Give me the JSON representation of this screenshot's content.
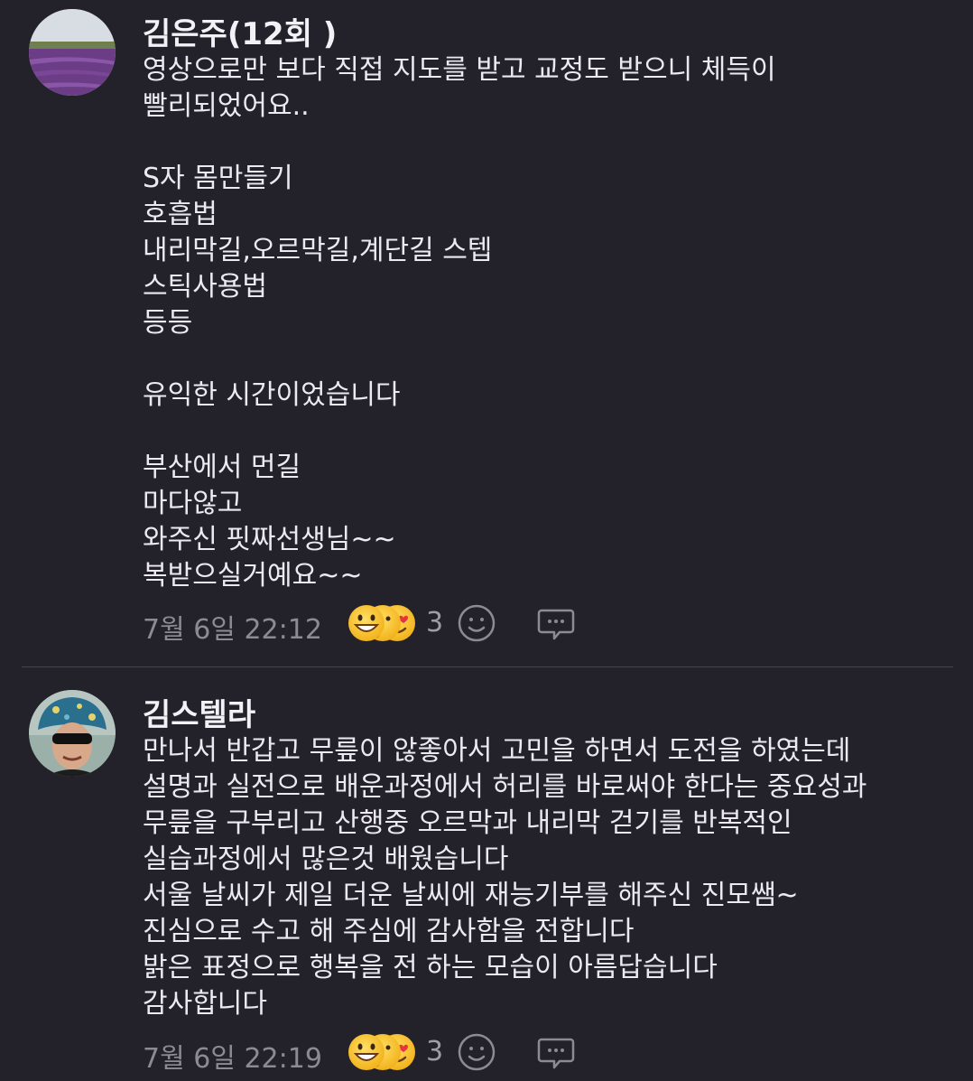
{
  "comments": [
    {
      "author": "김은주(12회 )",
      "text": "영상으로만 보다 직접 지도를 받고 교정도 받으니 체득이\n빨리되었어요..\n\nS자 몸만들기\n호흡법\n내리막길,오르막길,계단길 스텝\n스틱사용법\n등등\n\n유익한 시간이었습니다\n\n부산에서 먼길\n마다않고\n와주신 핏짜선생님~~\n복받으실거예요~~",
      "timestamp": "7월 6일 22:12",
      "reaction_count": "3",
      "reaction_icons": [
        "grinning-face-icon",
        "thumbs-up-face-icon",
        "heart-eyes-face-icon"
      ]
    },
    {
      "author": "김스텔라",
      "text": "만나서 반갑고 무릎이  않좋아서 고민을 하면서 도전을 하였는데\n설명과 실전으로 배운과정에서 허리를 바로써야 한다는 중요성과\n무릎을 구부리고 산행중 오르막과  내리막 걷기를 반복적인\n실습과정에서 많은것 배웠습니다\n서울 날씨가 제일 더운 날씨에 재능기부를 해주신 진모쌤~\n진심으로 수고 해 주심에 감사함을 전합니다\n밝은 표정으로 행복을 전 하는 모습이 아름답습니다\n감사합니다",
      "timestamp": "7월 6일 22:19",
      "reaction_count": "3",
      "reaction_icons": [
        "grinning-face-icon",
        "thumbs-up-face-icon",
        "heart-eyes-face-icon"
      ]
    }
  ],
  "colors": {
    "background": "#23222b",
    "text": "#eceaf0",
    "muted": "#8c8b93",
    "emoji_yellow": "#f7c52b",
    "heart_red": "#e8333c"
  }
}
